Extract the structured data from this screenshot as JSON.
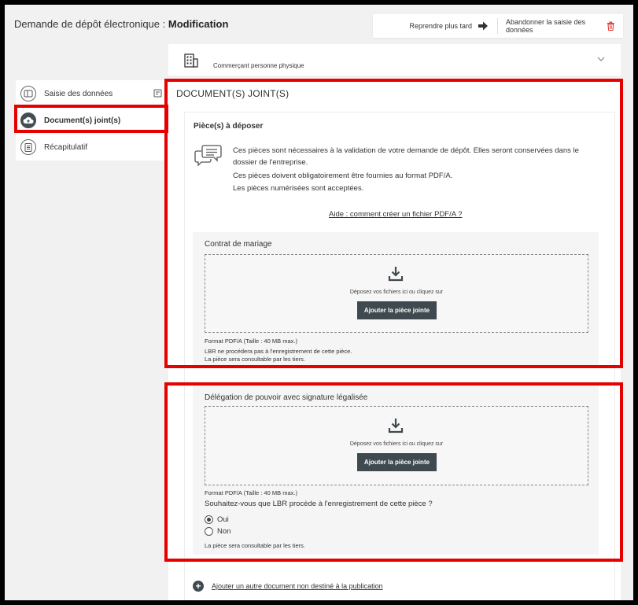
{
  "header": {
    "title_prefix": "Demande de dépôt électronique : ",
    "title_strong": "Modification",
    "resume_later": "Reprendre plus tard",
    "abandon": "Abandonner la saisie des données"
  },
  "entity": {
    "label": "Commerçant personne physique"
  },
  "sidebar": {
    "items": [
      {
        "label": "Saisie des données"
      },
      {
        "label": "Document(s) joint(s)"
      },
      {
        "label": "Récapitulatif"
      }
    ]
  },
  "main": {
    "section_title": "DOCUMENT(S) JOINT(S)",
    "pieces_title": "Pièce(s) à déposer",
    "info_lines": [
      "Ces pièces sont nécessaires à la validation de votre demande de dépôt. Elles seront conservées dans le dossier de l'entreprise.",
      "Ces pièces doivent obligatoirement être fournies au format PDF/A.",
      "Les pièces numérisées sont acceptées."
    ],
    "help_link": "Aide : comment créer un fichier PDF/A ?",
    "documents": [
      {
        "title": "Contrat de mariage",
        "drop_hint": "Déposez vos fichiers ici ou cliquez sur",
        "button": "Ajouter la pièce jointe",
        "format": "Format PDF/A (Taille : 40 MB max.)",
        "note1": "LBR ne procédera pas à l'enregistrement de cette pièce.",
        "note2": "La pièce sera consultable par les tiers."
      },
      {
        "title": "Délégation de pouvoir avec signature légalisée",
        "drop_hint": "Déposez vos fichiers ici ou cliquez sur",
        "button": "Ajouter la pièce jointe",
        "format": "Format PDF/A (Taille : 40 MB max.)",
        "question": "Souhaitez-vous que LBR procède à l'enregistrement de cette pièce ?",
        "option_yes": "Oui",
        "option_no": "Non",
        "selected": "Oui",
        "note": "La pièce sera consultable par les tiers."
      }
    ],
    "add_other": "Ajouter un autre document non destiné à la publication"
  },
  "colors": {
    "highlight": "#e60000",
    "button": "#3e4a4f",
    "delete_icon": "#e53935"
  }
}
